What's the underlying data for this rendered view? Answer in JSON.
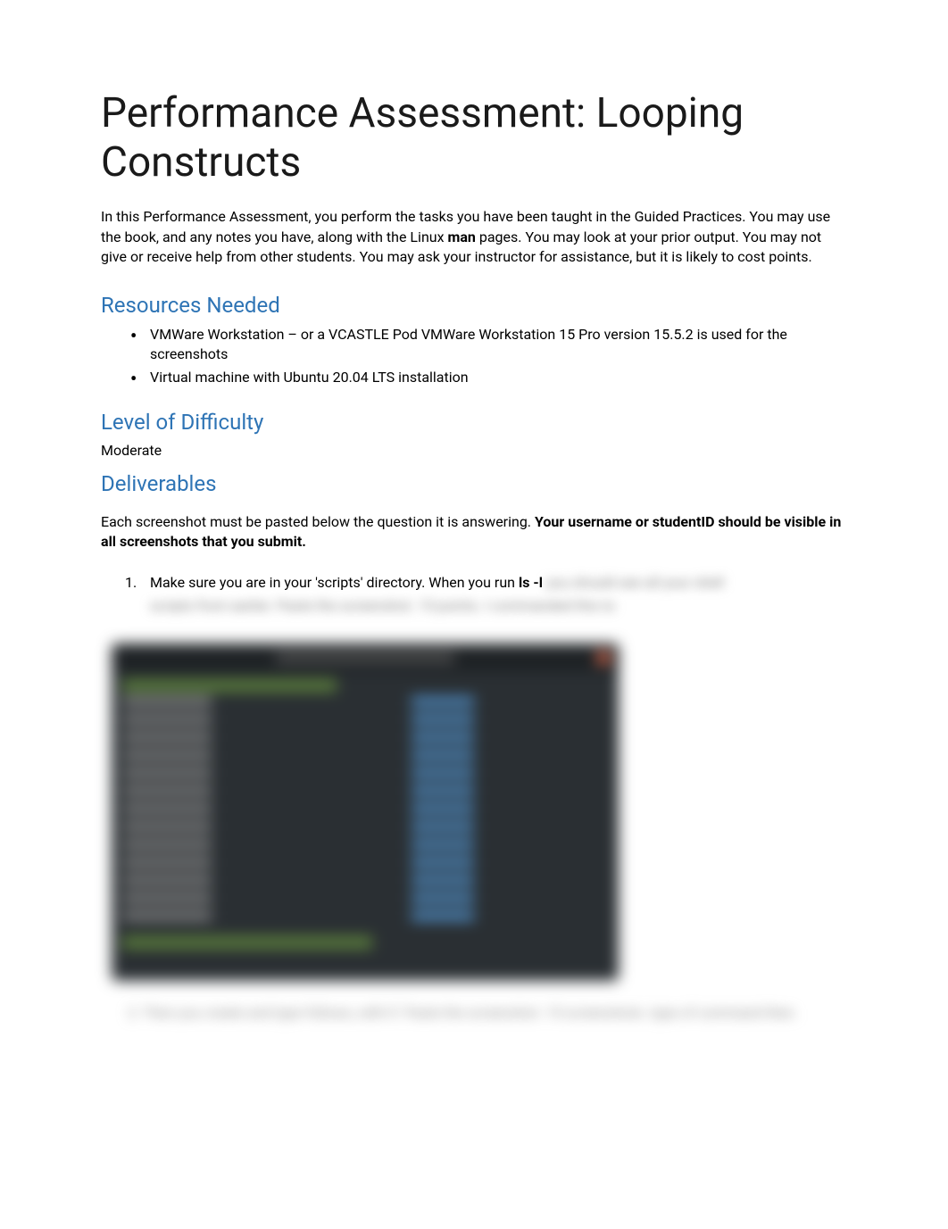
{
  "title": "Performance Assessment: Looping Constructs",
  "intro": {
    "part1": "In this Performance Assessment, you perform the tasks you have been taught in the Guided Practices.  You may use the book, and any notes you have, along with the Linux ",
    "bold1": "man",
    "part2": " pages.  You may look at your prior output.  You may not give or receive help from other students.  You may ask your instructor for assistance, but it is likely to cost points."
  },
  "sections": {
    "resources": {
      "heading": "Resources Needed",
      "items": [
        "VMWare Workstation – or a VCASTLE Pod VMWare Workstation 15 Pro version 15.5.2 is used for the screenshots",
        "Virtual machine with Ubuntu 20.04 LTS installation"
      ]
    },
    "difficulty": {
      "heading": "Level of Difficulty",
      "value": "Moderate"
    },
    "deliverables": {
      "heading": "Deliverables",
      "intro_part1": "Each screenshot must be pasted below the question it is answering. ",
      "intro_bold": "Your username or studentID should be visible in all screenshots that you submit."
    }
  },
  "questions": {
    "q1": {
      "number": "1.",
      "visible_text": "Make sure you are in your 'scripts' directory.  When you run ",
      "code": "ls -l",
      "blurred_inline": "you should see all your shell",
      "blurred_line2": "scripts from earlier.  Paste the screenshot.  15 points.  I commanded this to"
    },
    "q2_blurred": "2.   Then you create and type follows, with if.  Paste the screenshot.  15 screenshots.   type of command then."
  }
}
